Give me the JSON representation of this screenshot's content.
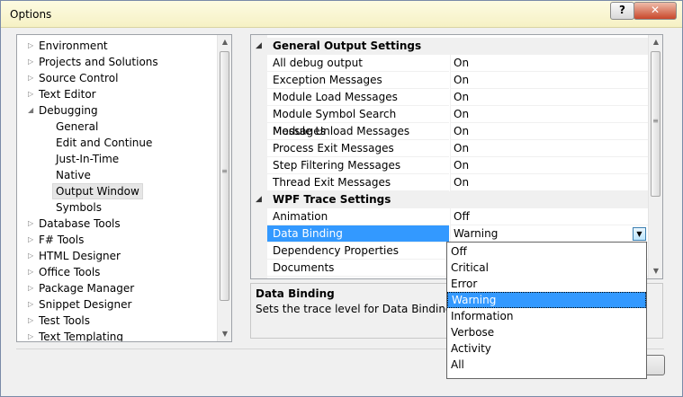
{
  "window": {
    "title": "Options",
    "help_glyph": "?",
    "close_glyph": "✕"
  },
  "tree": {
    "items": [
      {
        "label": "Environment",
        "expander": "▷"
      },
      {
        "label": "Projects and Solutions",
        "expander": "▷"
      },
      {
        "label": "Source Control",
        "expander": "▷"
      },
      {
        "label": "Text Editor",
        "expander": "▷"
      },
      {
        "label": "Debugging",
        "expander": "◢"
      },
      {
        "label": "General",
        "expander": ""
      },
      {
        "label": "Edit and Continue",
        "expander": ""
      },
      {
        "label": "Just-In-Time",
        "expander": ""
      },
      {
        "label": "Native",
        "expander": ""
      },
      {
        "label": "Output Window",
        "expander": "",
        "selected": true
      },
      {
        "label": "Symbols",
        "expander": ""
      },
      {
        "label": "Database Tools",
        "expander": "▷"
      },
      {
        "label": "F# Tools",
        "expander": "▷"
      },
      {
        "label": "HTML Designer",
        "expander": "▷"
      },
      {
        "label": "Office Tools",
        "expander": "▷"
      },
      {
        "label": "Package Manager",
        "expander": "▷"
      },
      {
        "label": "Snippet Designer",
        "expander": "▷"
      },
      {
        "label": "Test Tools",
        "expander": "▷"
      },
      {
        "label": "Text Templating",
        "expander": "▷"
      }
    ],
    "scroll_up_glyph": "▲",
    "scroll_down_glyph": "▼",
    "grip_glyph": "≡"
  },
  "grid": {
    "rows": [
      {
        "kind": "category",
        "label": "General Output Settings",
        "expander": "◢"
      },
      {
        "kind": "property",
        "name": "All debug output",
        "value": "On"
      },
      {
        "kind": "property",
        "name": "Exception Messages",
        "value": "On"
      },
      {
        "kind": "property",
        "name": "Module Load Messages",
        "value": "On"
      },
      {
        "kind": "property",
        "name": "Module Symbol Search Messages",
        "value": "On"
      },
      {
        "kind": "property",
        "name": "Module Unload Messages",
        "value": "On"
      },
      {
        "kind": "property",
        "name": "Process Exit Messages",
        "value": "On"
      },
      {
        "kind": "property",
        "name": "Step Filtering Messages",
        "value": "On"
      },
      {
        "kind": "property",
        "name": "Thread Exit Messages",
        "value": "On"
      },
      {
        "kind": "category",
        "label": "WPF Trace Settings",
        "expander": "◢"
      },
      {
        "kind": "property",
        "name": "Animation",
        "value": "Off"
      },
      {
        "kind": "property",
        "name": "Data Binding",
        "value": "Warning",
        "selected": true
      },
      {
        "kind": "property",
        "name": "Dependency Properties",
        "value": ""
      },
      {
        "kind": "property",
        "name": "Documents",
        "value": ""
      }
    ],
    "dropdown_glyph": "▼",
    "scroll_up_glyph": "▲",
    "scroll_down_glyph": "▼",
    "grip_glyph": "≡"
  },
  "description": {
    "title": "Data Binding",
    "text": "Sets the trace level for Data Binding in W"
  },
  "dropdown": {
    "options": [
      "Off",
      "Critical",
      "Error",
      "Warning",
      "Information",
      "Verbose",
      "Activity",
      "All"
    ],
    "selected": "Warning"
  },
  "colors": {
    "selection": "#3399ff",
    "titlebar": "#f6f1c4",
    "close_button": "#c9472a"
  }
}
